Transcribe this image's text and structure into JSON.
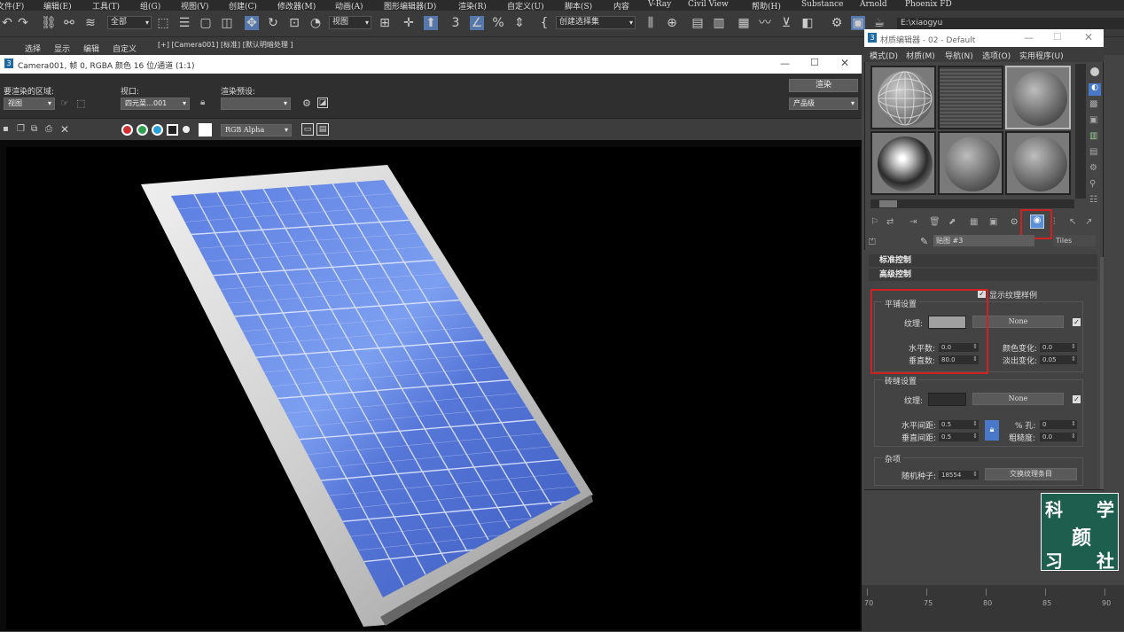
{
  "menubar": {
    "items": [
      "文件(F)",
      "编辑(E)",
      "工具(T)",
      "组(G)",
      "视图(V)",
      "创建(C)",
      "修改器(M)",
      "动画(A)",
      "图形编辑器(D)",
      "渲染(R)",
      "自定义(U)",
      "脚本(S)",
      "内容",
      "V-Ray",
      "Civil View",
      "帮助(H)",
      "Substance",
      "Arnold",
      "Phoenix FD"
    ]
  },
  "toolbar": {
    "selection_filter": "全部",
    "ref_coord": "视图",
    "named_selection": "创建选择集",
    "path": "E:\\xiaogyu"
  },
  "ribbon": {
    "tabs": [
      "选择",
      "显示",
      "编辑",
      "自定义"
    ],
    "viewport_label": "[+] [Camera001] [标准] [默认明暗处理 ]"
  },
  "render_window": {
    "title": "Camera001, 帧 0, RGBA 颜色 16 位/通道 (1:1)",
    "area_label": "要渲染的区域:",
    "area_value": "视图",
    "viewport_label": "视口:",
    "viewport_value": "四元菜…001",
    "preset_label": "渲染预设:",
    "preset_value": "",
    "render_button": "渲染",
    "output_value": "产品级",
    "channel_value": "RGB Alpha"
  },
  "material_editor": {
    "title": "材质编辑器 - 02 - Default",
    "menu": [
      "模式(D)",
      "材质(M)",
      "导航(N)",
      "选项(O)",
      "实用程序(U)"
    ],
    "map_name": "贴图 #3",
    "map_type": "Tiles",
    "rollouts": {
      "standard": "标准控制",
      "advanced": "高级控制"
    },
    "show_texture_swatches": "显示纹理样例",
    "tiles_setup": {
      "title": "平铺设置",
      "texture_label": "纹理:",
      "texture_button": "None",
      "horiz_count_label": "水平数:",
      "horiz_count": "0.0",
      "vert_count_label": "垂直数:",
      "vert_count": "80.0",
      "color_variance_label": "颜色变化:",
      "color_variance": "0.0",
      "fade_variance_label": "淡出变化:",
      "fade_variance": "0.05"
    },
    "grout_setup": {
      "title": "砖缝设置",
      "texture_label": "纹理:",
      "texture_button": "None",
      "horiz_gap_label": "水平间距:",
      "horiz_gap": "0.5",
      "vert_gap_label": "垂直间距:",
      "vert_gap": "0.5",
      "holes_label": "% 孔:",
      "holes": "0",
      "rough_label": "粗糙度:",
      "rough": "0.0"
    },
    "misc": {
      "title": "杂项",
      "seed_label": "随机种子:",
      "seed": "18554",
      "swap_button": "交换纹理条目"
    }
  },
  "timeline": {
    "labels": [
      "70",
      "75",
      "80",
      "85",
      "90"
    ]
  },
  "watermark": {
    "chars": [
      "科",
      "学",
      "颜",
      "习",
      "社"
    ]
  },
  "colors": {
    "accent_red": "#d02020",
    "panel": "#454545",
    "solar_blue": "#4a6bd0"
  }
}
